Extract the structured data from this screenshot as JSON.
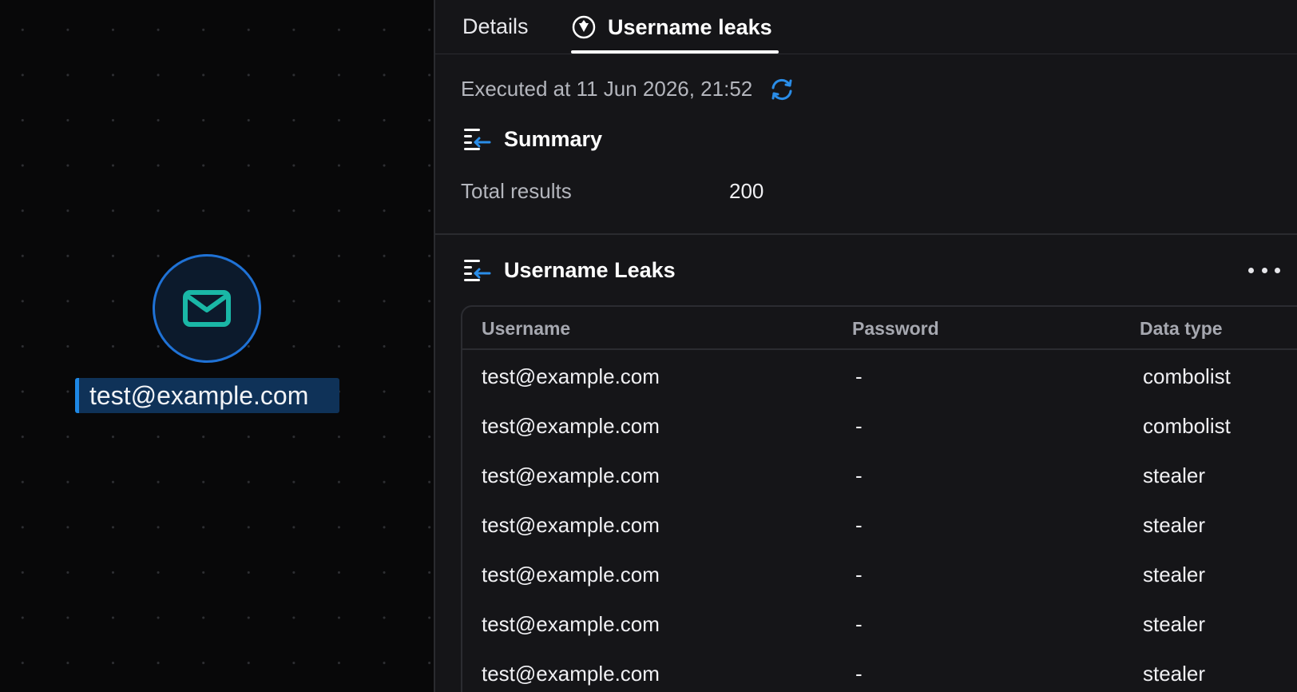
{
  "canvas": {
    "node": {
      "icon": "mail-icon",
      "label": "test@example.com",
      "accent": "#1e88e5",
      "icon_color": "#1ab7a6"
    }
  },
  "tabs": [
    {
      "label": "Details",
      "active": false
    },
    {
      "label": "Username leaks",
      "icon": "leak-globe-icon",
      "active": true
    }
  ],
  "execution": {
    "text": "Executed at 11 Jun 2026, 21:52",
    "refresh_icon": "refresh-icon"
  },
  "summary": {
    "title": "Summary",
    "icon": "summary-list-icon",
    "rows": [
      {
        "key": "Total results",
        "value": "200"
      }
    ]
  },
  "leaks": {
    "title": "Username Leaks",
    "icon": "leaks-list-icon",
    "more_icon": "more-horizontal-icon",
    "columns": [
      "Username",
      "Password",
      "Data type"
    ],
    "rows": [
      {
        "username": "test@example.com",
        "password": "-",
        "data_type": "combolist"
      },
      {
        "username": "test@example.com",
        "password": "-",
        "data_type": "combolist"
      },
      {
        "username": "test@example.com",
        "password": "-",
        "data_type": "stealer"
      },
      {
        "username": "test@example.com",
        "password": "-",
        "data_type": "stealer"
      },
      {
        "username": "test@example.com",
        "password": "-",
        "data_type": "stealer"
      },
      {
        "username": "test@example.com",
        "password": "-",
        "data_type": "stealer"
      },
      {
        "username": "test@example.com",
        "password": "-",
        "data_type": "stealer"
      }
    ]
  },
  "colors": {
    "background": "#151518",
    "canvas": "#080809",
    "accent_blue": "#1e88e5",
    "teal": "#1ab7a6"
  }
}
